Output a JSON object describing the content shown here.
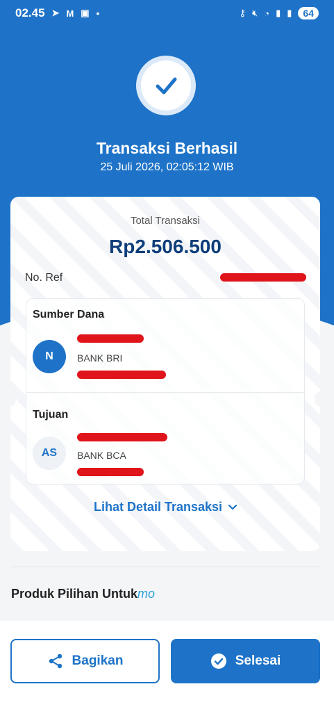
{
  "status_bar": {
    "time": "02.45",
    "battery": "64",
    "left_icons": [
      "nav-arrow-icon",
      "gmail-icon",
      "bri-app-icon",
      "dot-icon"
    ],
    "right_icons": [
      "key-icon",
      "mute-icon",
      "wifi-icon",
      "signal-icon",
      "signal-icon"
    ]
  },
  "header": {
    "title": "Transaksi Berhasil",
    "datetime": "25 Juli 2026, 02:05:12 WIB"
  },
  "receipt": {
    "total_label": "Total Transaksi",
    "total_amount": "Rp2.506.500",
    "ref_label": "No. Ref",
    "source": {
      "section_title": "Sumber Dana",
      "avatar_initials": "N",
      "bank": "BANK BRI"
    },
    "destination": {
      "section_title": "Tujuan",
      "avatar_initials": "AS",
      "bank": "BANK BCA"
    },
    "detail_link": "Lihat Detail Transaksi"
  },
  "promo": {
    "title": "Produk Pilihan Untuk",
    "brand": "mo"
  },
  "actions": {
    "share_label": "Bagikan",
    "done_label": "Selesai"
  },
  "colors": {
    "primary": "#1e73c8",
    "amount": "#0e3e7a",
    "redaction": "#e0141b",
    "brand_mo": "#2aa3d8"
  }
}
